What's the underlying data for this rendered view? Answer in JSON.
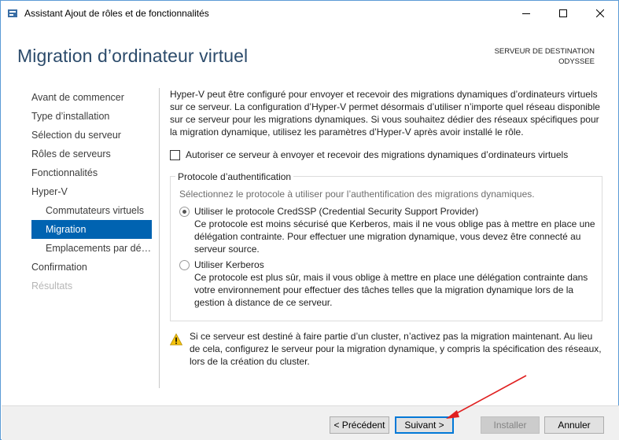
{
  "window": {
    "title": "Assistant Ajout de rôles et de fonctionnalités"
  },
  "header": {
    "page_title": "Migration d’ordinateur virtuel",
    "destination_label": "SERVEUR DE DESTINATION",
    "destination_name": "ODYSSEE"
  },
  "nav": {
    "items": [
      {
        "label": "Avant de commencer",
        "state": "normal"
      },
      {
        "label": "Type d’installation",
        "state": "normal"
      },
      {
        "label": "Sélection du serveur",
        "state": "normal"
      },
      {
        "label": "Rôles de serveurs",
        "state": "normal"
      },
      {
        "label": "Fonctionnalités",
        "state": "normal"
      },
      {
        "label": "Hyper-V",
        "state": "normal"
      },
      {
        "label": "Commutateurs virtuels",
        "state": "sub"
      },
      {
        "label": "Migration",
        "state": "active"
      },
      {
        "label": "Emplacements par défaut",
        "state": "sub"
      },
      {
        "label": "Confirmation",
        "state": "normal"
      },
      {
        "label": "Résultats",
        "state": "disabled"
      }
    ]
  },
  "content": {
    "intro": "Hyper-V peut être configuré pour envoyer et recevoir des migrations dynamiques d’ordinateurs virtuels sur ce serveur. La configuration d’Hyper-V permet désormais d’utiliser n’importe quel réseau disponible sur ce serveur pour les migrations dynamiques. Si vous souhaitez dédier des réseaux spécifiques pour la migration dynamique, utilisez les paramètres d’Hyper-V après avoir installé le rôle.",
    "checkbox_label": "Autoriser ce serveur à envoyer et recevoir des migrations dynamiques d’ordinateurs virtuels",
    "checkbox_checked": false,
    "auth_group": {
      "legend": "Protocole d’authentification",
      "hint": "Sélectionnez le protocole à utiliser pour l’authentification des migrations dynamiques.",
      "credssp_label": "Utiliser le protocole CredSSP (Credential Security Support Provider)",
      "credssp_desc": "Ce protocole est moins sécurisé que Kerberos, mais il ne vous oblige pas à mettre en place une délégation contrainte. Pour effectuer une migration dynamique, vous devez être connecté au serveur source.",
      "kerberos_label": "Utiliser Kerberos",
      "kerberos_desc": "Ce protocole est plus sûr, mais il vous oblige à mettre en place une délégation contrainte dans votre environnement pour effectuer des tâches telles que la migration dynamique lors de la gestion à distance de ce serveur.",
      "selected": "credssp"
    },
    "warning": "Si ce serveur est destiné à faire partie d’un cluster, n’activez pas la migration maintenant. Au lieu de cela, configurez le serveur pour la migration dynamique, y compris la spécification des réseaux, lors de la création du cluster."
  },
  "footer": {
    "prev_label": "< Précédent",
    "next_label": "Suivant >",
    "install_label": "Installer",
    "cancel_label": "Annuler"
  },
  "colors": {
    "accent": "#0063b1",
    "title": "#2c4b6b",
    "annotation_arrow": "#e02020"
  }
}
